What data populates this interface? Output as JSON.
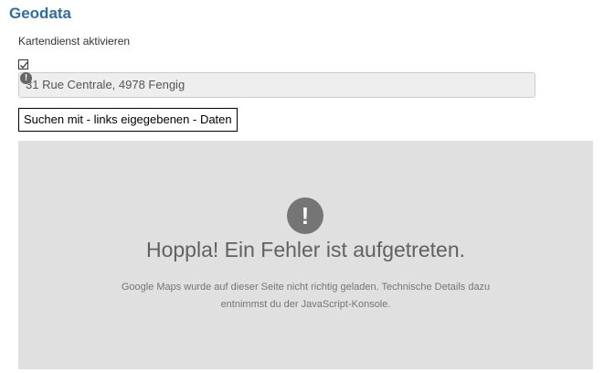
{
  "section": {
    "title": "Geodata"
  },
  "map_service": {
    "checkbox_label": "Kartendienst aktivieren",
    "checked": true
  },
  "address": {
    "value": "31 Rue Centrale, 4978 Fengig"
  },
  "search": {
    "button_label": "Suchen mit - links eigegebenen - Daten"
  },
  "map_error": {
    "icon_glyph": "!",
    "title": "Hoppla! Ein Fehler ist aufgetreten.",
    "message_line1": "Google Maps wurde auf dieser Seite nicht richtig geladen. Technische Details dazu",
    "message_line2": "entnimmst du der JavaScript-Konsole."
  },
  "colors": {
    "title_blue": "#2f6e9f",
    "map_background": "#e0e0e0",
    "error_icon": "#757575"
  }
}
